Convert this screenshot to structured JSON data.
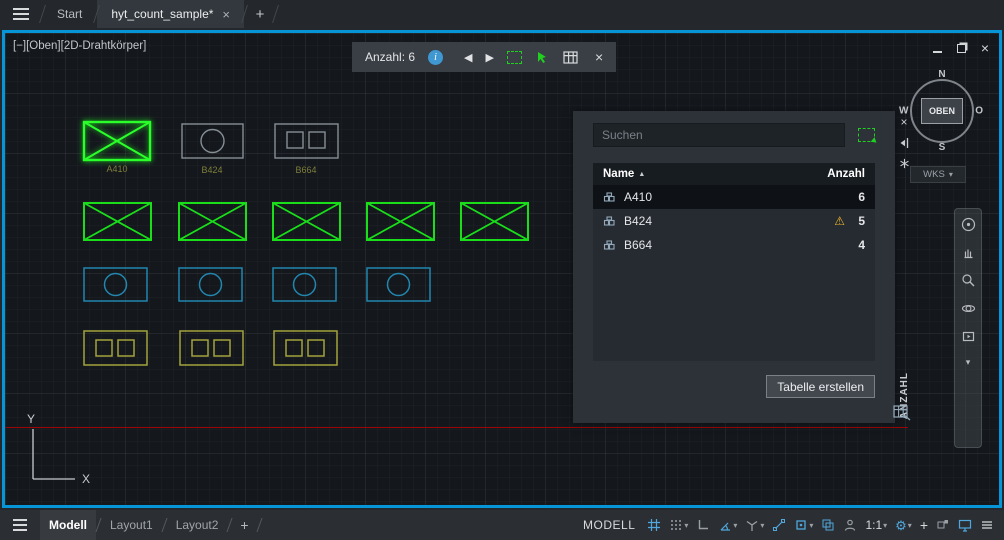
{
  "tabbar": {
    "start_tab": "Start",
    "active_tab": "hyt_count_sample*"
  },
  "icons": {
    "close": "×",
    "minimize": "—",
    "chevron_down": "▾",
    "sort_asc": "▲",
    "warning": "⚠",
    "gear": "⚙",
    "plus": "+",
    "arrow_left": "◀",
    "arrow_right": "▶",
    "info": "i"
  },
  "viewport": {
    "label": "[−][Oben][2D-Drahtkörper]"
  },
  "count_toolbar": {
    "count_label": "Anzahl: 6"
  },
  "viewcube": {
    "front": "OBEN",
    "north": "N",
    "east": "O",
    "south": "S",
    "west": "W"
  },
  "wks": {
    "label": "WKS"
  },
  "canvas_labels": {
    "a": "A410",
    "b": "B424",
    "c": "B664"
  },
  "palette": {
    "search_placeholder": "Suchen",
    "columns": {
      "name": "Name",
      "count": "Anzahl"
    },
    "rows": [
      {
        "name": "A410",
        "count": 6,
        "selected": true,
        "warning": false
      },
      {
        "name": "B424",
        "count": 5,
        "selected": false,
        "warning": true
      },
      {
        "name": "B664",
        "count": 4,
        "selected": false,
        "warning": false
      }
    ],
    "create_table_button": "Tabelle erstellen",
    "title_vertical": "ANZAHL"
  },
  "statusbar": {
    "model_tab": "Modell",
    "layout1_tab": "Layout1",
    "layout2_tab": "Layout2",
    "modell_label": "MODELL",
    "scale": "1:1"
  },
  "colors": {
    "viewport_border": "#0696d7",
    "highlight_green": "#1ade1a",
    "block_gray": "#858d95",
    "block_blue": "#2286ae",
    "block_yellow": "#a3a33c",
    "warning_yellow": "#f0b429",
    "axis_red": "#9c0606",
    "active_icon_blue": "#4fa7dd"
  }
}
